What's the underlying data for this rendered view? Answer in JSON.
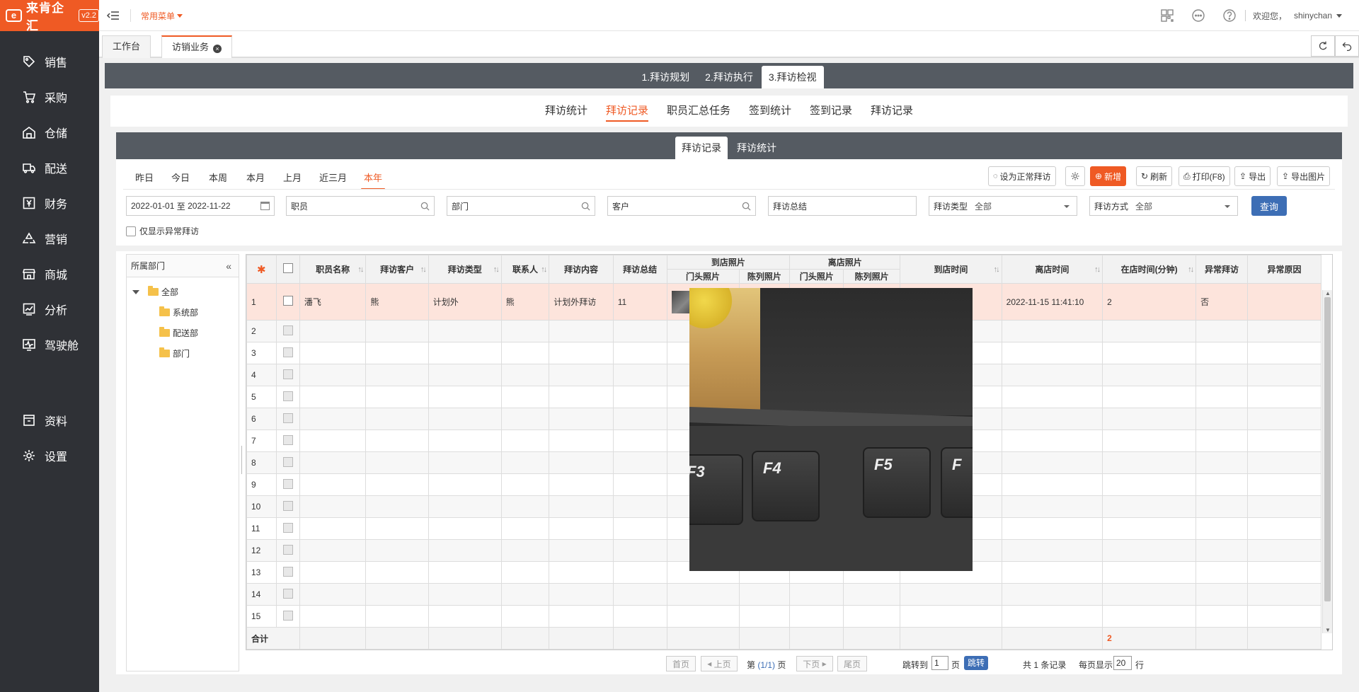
{
  "app": {
    "logo_text": "来肯企汇",
    "version": "v2.2"
  },
  "sidebar": {
    "main": [
      {
        "label": "销售",
        "icon": "tag-icon"
      },
      {
        "label": "采购",
        "icon": "cart-icon"
      },
      {
        "label": "仓储",
        "icon": "warehouse-icon"
      },
      {
        "label": "配送",
        "icon": "truck-icon"
      },
      {
        "label": "财务",
        "icon": "yen-icon"
      },
      {
        "label": "营销",
        "icon": "recycle-icon"
      },
      {
        "label": "商城",
        "icon": "store-icon"
      },
      {
        "label": "分析",
        "icon": "chart-icon"
      },
      {
        "label": "驾驶舱",
        "icon": "dashboard-icon"
      }
    ],
    "sub": [
      {
        "label": "资料",
        "icon": "archive-icon"
      },
      {
        "label": "设置",
        "icon": "gear-icon"
      }
    ]
  },
  "topbar": {
    "favorites": "常用菜单",
    "welcome": "欢迎您，",
    "user": "shinychan"
  },
  "page_tabs": [
    {
      "label": "工作台"
    },
    {
      "label": "访销业务"
    }
  ],
  "steps": [
    "1.拜访规划",
    "2.拜访执行",
    "3.拜访检视"
  ],
  "subnav": [
    "拜访统计",
    "拜访记录",
    "职员汇总任务",
    "签到统计",
    "签到记录",
    "拜访记录"
  ],
  "inner_tabs": [
    "拜访记录",
    "拜访统计"
  ],
  "quick_dates": [
    "昨日",
    "今日",
    "本周",
    "本月",
    "上月",
    "近三月",
    "本年"
  ],
  "toolbar": {
    "set_normal": "设为正常拜访",
    "add": "新增",
    "refresh": "刷新",
    "print": "打印(F8)",
    "export": "导出",
    "export_image": "导出图片"
  },
  "filters": {
    "date_from": "2022-01-01",
    "date_sep": "至",
    "date_to": "2022-11-22",
    "employee": "职员",
    "department": "部门",
    "customer": "客户",
    "summary": "拜访总结",
    "visit_type_label": "拜访类型",
    "visit_type_value": "全部",
    "visit_method_label": "拜访方式",
    "visit_method_value": "全部",
    "query": "查询",
    "only_abnormal": "仅显示异常拜访"
  },
  "tree": {
    "title": "所属部门",
    "root": "全部",
    "children": [
      "系统部",
      "配送部",
      "部门"
    ]
  },
  "grid": {
    "headers": {
      "employee": "职员名称",
      "customer": "拜访客户",
      "type": "拜访类型",
      "contact": "联系人",
      "content": "拜访内容",
      "summary": "拜访总结",
      "arrive_photos": "到店照片",
      "leave_photos": "离店照片",
      "door_photo": "门头照片",
      "display_photo": "陈列照片",
      "door_photo2": "门头照片",
      "display_photo2": "陈列照片",
      "arrive_time": "到店时间",
      "leave_time": "离店时间",
      "stay_minutes": "在店时间(分钟)",
      "abnormal": "异常拜访",
      "abnormal_reason": "异常原因"
    },
    "row1": {
      "num": "1",
      "employee": "潘飞",
      "customer": "熊",
      "type": "计划外",
      "contact": "熊",
      "content": "计划外拜访",
      "summary": "11",
      "leave_time": "2022-11-15 11:41:10",
      "stay": "2",
      "abnormal": "否"
    },
    "row_numbers": [
      "2",
      "3",
      "4",
      "5",
      "6",
      "7",
      "8",
      "9",
      "10",
      "11",
      "12",
      "13",
      "14",
      "15"
    ],
    "total_label": "合计",
    "total_stay": "2"
  },
  "photo": {
    "keys": [
      "F3",
      "F4",
      "F5",
      "F"
    ]
  },
  "pager": {
    "first": "首页",
    "prev": "上页",
    "page_prefix": "第",
    "page_info": "(1/1)",
    "page_suffix": "页",
    "next": "下页",
    "last": "尾页",
    "jump_to": "跳转到",
    "jump_value": "1",
    "jump_unit": "页",
    "jump_btn": "跳转",
    "records": "共 1 条记录",
    "per_page_label": "每页显示",
    "per_page": "20",
    "per_page_unit": "行"
  }
}
